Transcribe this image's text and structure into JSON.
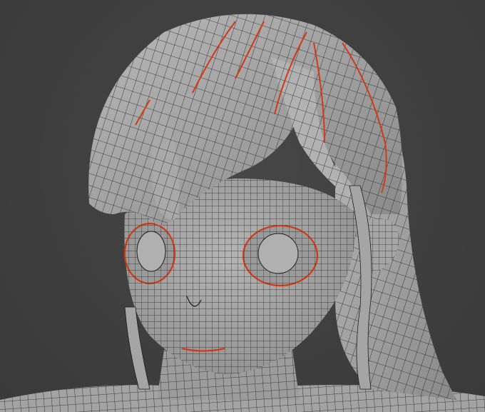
{
  "viewport": {
    "background_color": "#3f3f3f",
    "mesh_fill_color": "#a8a8a8",
    "mesh_shade_color": "#8e8e8e",
    "wire_color": "#1e1e1e",
    "seam_color": "#d23a14",
    "subject": "anime-character-head-wireframe"
  }
}
